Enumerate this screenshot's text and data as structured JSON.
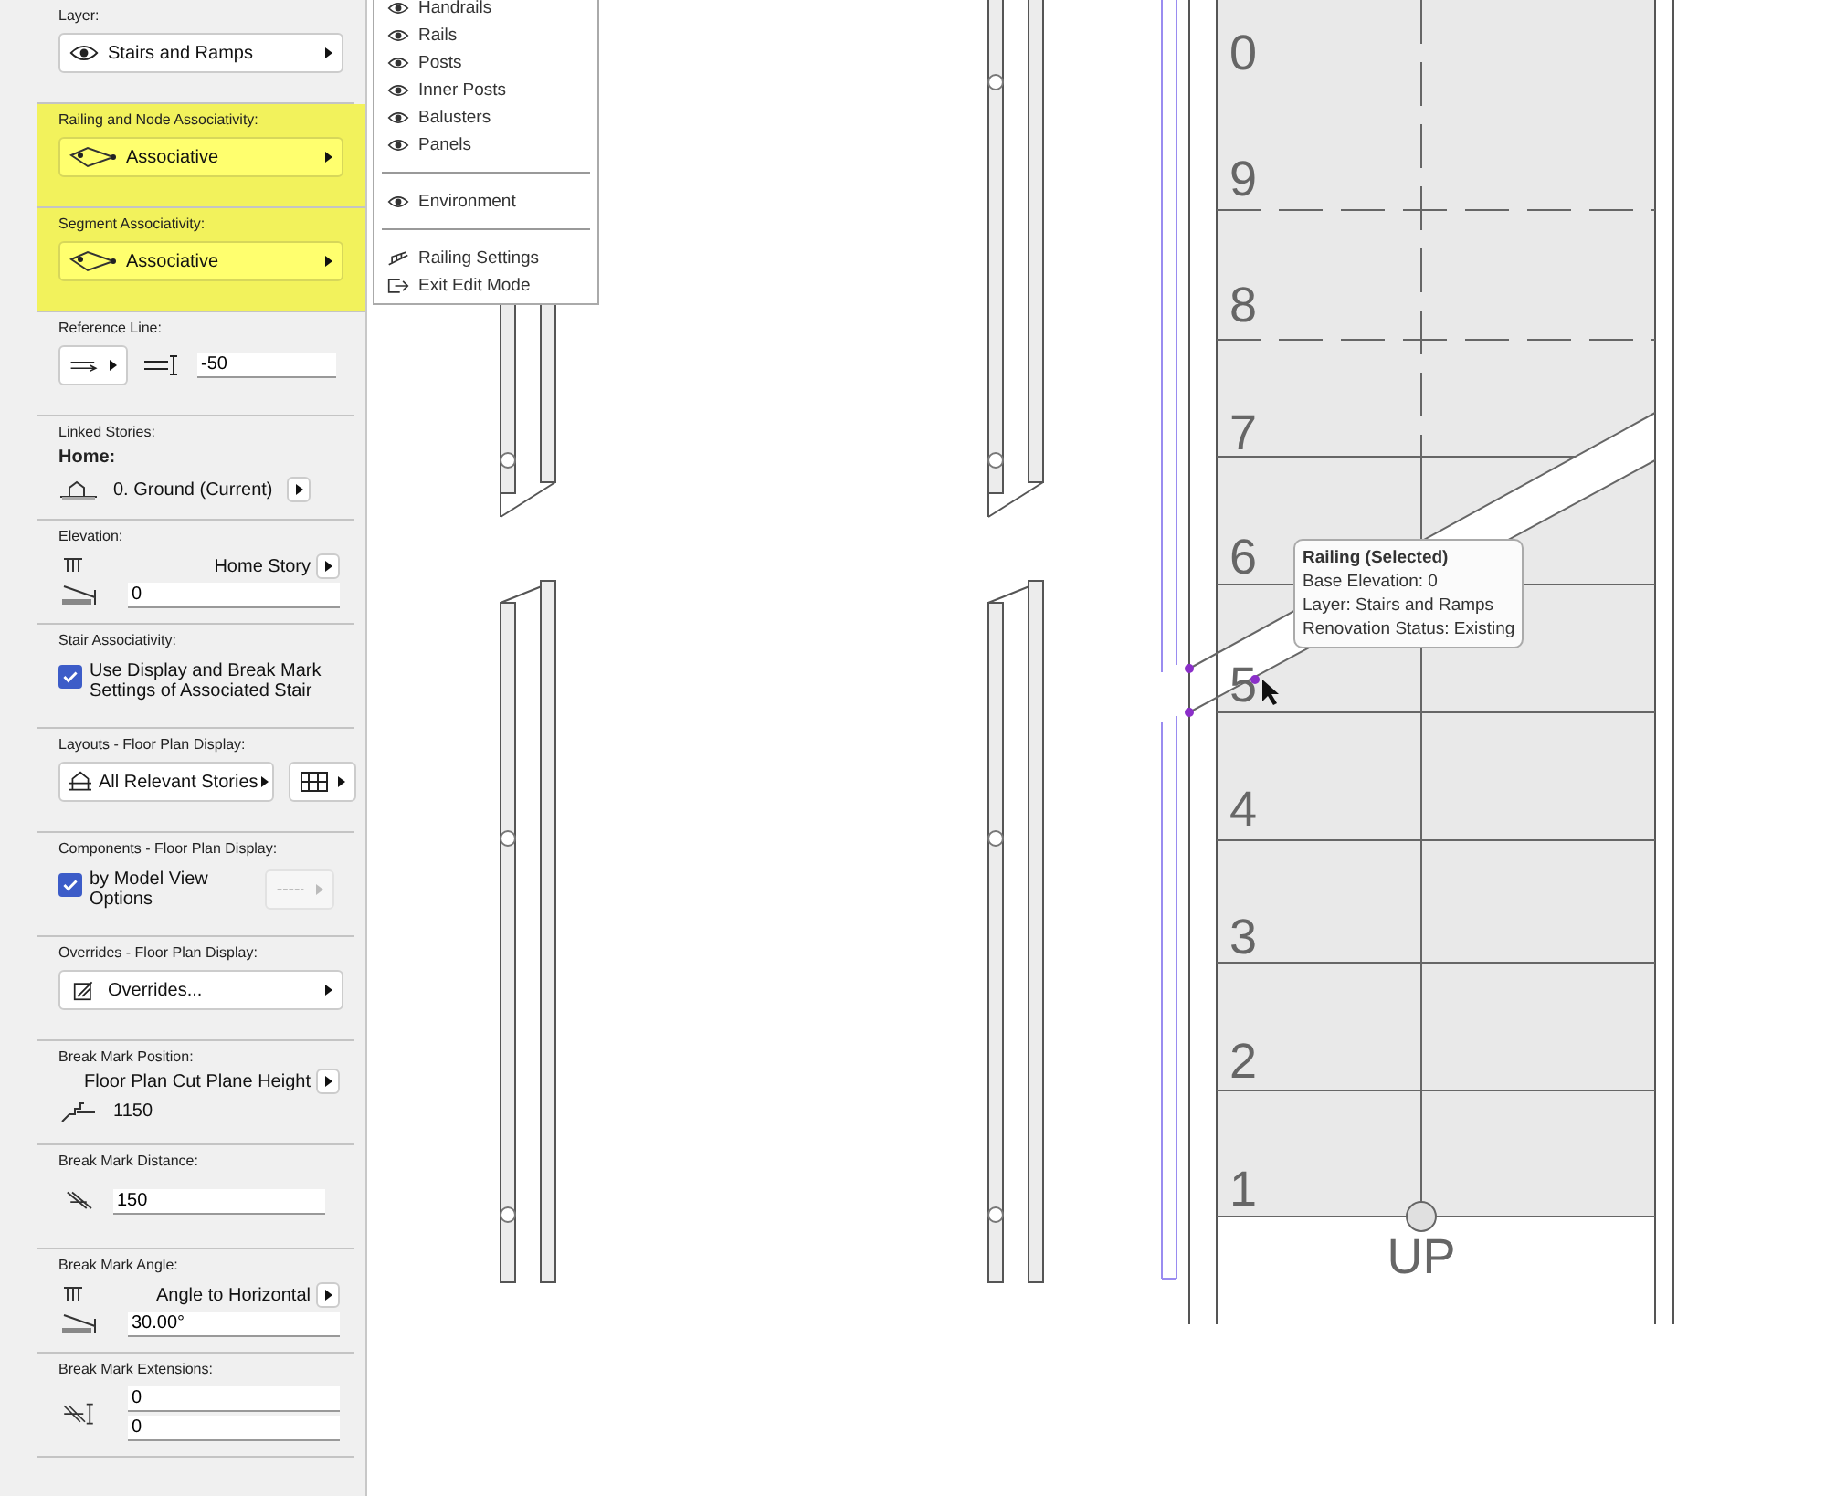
{
  "panel": {
    "sections": [
      {
        "kind": "layer",
        "label": "Layer:",
        "value": "Stairs and Ramps",
        "highlighted": false
      },
      {
        "kind": "associativity",
        "label": "Railing and Node Associativity:",
        "value": "Associative",
        "highlighted": true
      },
      {
        "kind": "associativity",
        "label": "Segment Associativity:",
        "value": "Associative",
        "highlighted": true
      },
      {
        "kind": "reference",
        "label": "Reference Line:",
        "value": "-50"
      },
      {
        "kind": "stories",
        "label": "Linked Stories:",
        "home": "Home:",
        "value": "0. Ground (Current)"
      },
      {
        "kind": "elevation",
        "label": "Elevation:",
        "option": "Home Story",
        "value": "0"
      },
      {
        "kind": "checkbox",
        "label": "Stair Associativity:",
        "text": "Use Display and Break Mark Settings of Associated Stair",
        "checked": true
      },
      {
        "kind": "layouts",
        "label": "Layouts - Floor Plan Display:",
        "value": "All Relevant Stories"
      },
      {
        "kind": "components",
        "label": "Components - Floor Plan Display:",
        "text": "by Model View Options",
        "checked": true
      },
      {
        "kind": "overrides",
        "label": "Overrides - Floor Plan Display:",
        "value": "Overrides..."
      },
      {
        "kind": "position",
        "label": "Break Mark Position:",
        "option": "Floor Plan Cut Plane Height",
        "value": "1150"
      },
      {
        "kind": "distance",
        "label": "Break Mark Distance:",
        "value": "150"
      },
      {
        "kind": "angle",
        "label": "Break Mark Angle:",
        "option": "Angle to Horizontal",
        "value": "30.00°"
      },
      {
        "kind": "extensions",
        "label": "Break Mark Extensions:",
        "values": [
          "0",
          "0"
        ]
      }
    ]
  },
  "menu": {
    "groups": [
      [
        {
          "kind": "visibility",
          "label": "Handrails"
        },
        {
          "kind": "visibility",
          "label": "Rails"
        },
        {
          "kind": "visibility",
          "label": "Posts"
        },
        {
          "kind": "visibility",
          "label": "Inner Posts"
        },
        {
          "kind": "visibility",
          "label": "Balusters"
        },
        {
          "kind": "visibility",
          "label": "Panels"
        }
      ],
      [
        {
          "kind": "visibility",
          "label": "Environment"
        }
      ],
      [
        {
          "kind": "settings",
          "label": "Railing Settings"
        },
        {
          "kind": "exit",
          "label": "Exit Edit Mode"
        }
      ]
    ]
  },
  "plan": {
    "steps": [
      "0",
      "9",
      "8",
      "7",
      "6",
      "5",
      "4",
      "3",
      "2",
      "1"
    ],
    "direction": "UP"
  },
  "tooltip": {
    "title": "Railing (Selected)",
    "lines": [
      "Base Elevation: 0",
      "Layer: Stairs and Ramps",
      "Renovation Status: Existing"
    ]
  }
}
